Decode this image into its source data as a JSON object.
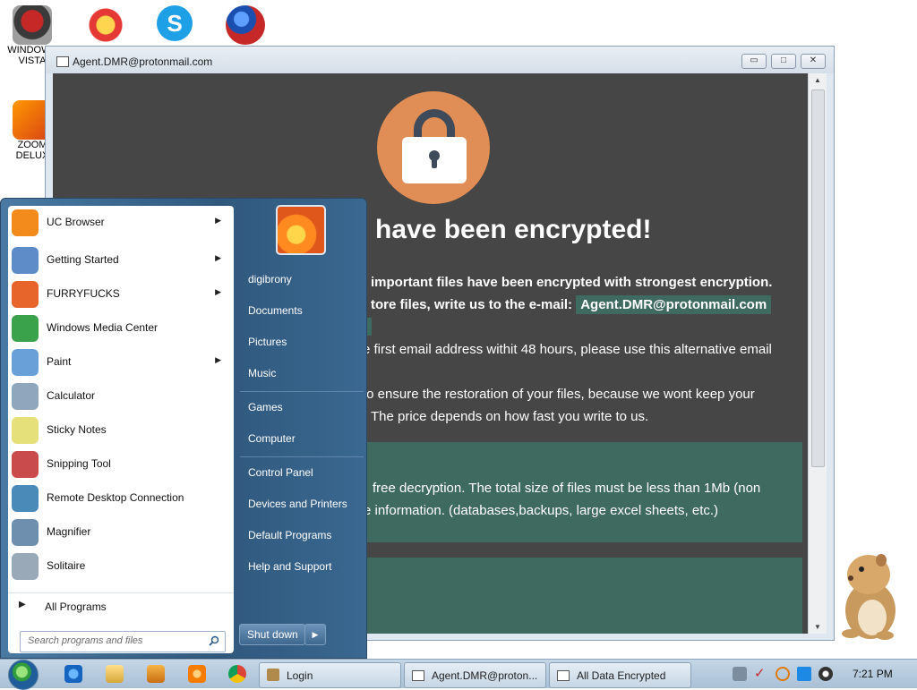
{
  "desktop": {
    "icons": [
      {
        "label": "WINDOWS VISTA",
        "icon": "windows-vista-icon"
      },
      {
        "label": "",
        "icon": "p-logo-icon"
      },
      {
        "label": "",
        "icon": "skype-icon"
      },
      {
        "label": "",
        "icon": "globe-icon"
      },
      {
        "label": "ZOOM DELUX",
        "icon": "zoom-deluxe-icon"
      }
    ]
  },
  "ransom_window": {
    "title": "Agent.DMR@protonmail.com",
    "controls": {
      "minimize": "▭",
      "maximize": "□",
      "close": "✕"
    },
    "heading": "have been encrypted!",
    "line1": "important files have been encrypted with strongest encryption.",
    "line2_prefix": "tore files, write us to the e-mail:",
    "email": "Agent.DMR@protonmail.com",
    "line3": "e first email address withit 48 hours, please use this alternative email",
    "line4": "to ensure the restoration of your files, because we wont keep your",
    "line5": "The price depends on how fast you write to us.",
    "box_line1": "free decryption. The total size of files must be less than 1Mb (non",
    "box_line2": "e information. (databases,backups, large excel sheets, etc.)"
  },
  "start_menu": {
    "programs": [
      {
        "label": "UC Browser",
        "icon": "uc-browser-icon",
        "submenu": true,
        "color": "#f28b1c"
      },
      {
        "label": "Getting Started",
        "icon": "getting-started-icon",
        "submenu": true,
        "color": "#5d8cc9"
      },
      {
        "label": "FURRYFUCKS",
        "icon": "firefox-icon",
        "submenu": true,
        "color": "#e7642a"
      },
      {
        "label": "Windows Media Center",
        "icon": "media-center-icon",
        "submenu": false,
        "color": "#3aa24a"
      },
      {
        "label": "Paint",
        "icon": "paint-icon",
        "submenu": true,
        "color": "#6aa0d8"
      },
      {
        "label": "Calculator",
        "icon": "calculator-icon",
        "submenu": false,
        "color": "#8fa6bd"
      },
      {
        "label": "Sticky Notes",
        "icon": "sticky-notes-icon",
        "submenu": false,
        "color": "#e6e07a"
      },
      {
        "label": "Snipping Tool",
        "icon": "snipping-tool-icon",
        "submenu": false,
        "color": "#c94b4b"
      },
      {
        "label": "Remote Desktop Connection",
        "icon": "remote-desktop-icon",
        "submenu": false,
        "color": "#4a8ab8"
      },
      {
        "label": "Magnifier",
        "icon": "magnifier-icon",
        "submenu": false,
        "color": "#6f8faf"
      },
      {
        "label": "Solitaire",
        "icon": "solitaire-icon",
        "submenu": false,
        "color": "#9aa9b8"
      }
    ],
    "all_programs": "All Programs",
    "search_placeholder": "Search programs and files",
    "right_items": [
      "digibrony",
      "Documents",
      "Pictures",
      "Music",
      "Games",
      "Computer",
      "Control Panel",
      "Devices and Printers",
      "Default Programs",
      "Help and Support"
    ],
    "shutdown": "Shut down"
  },
  "taskbar": {
    "buttons": [
      "Login",
      "Agent.DMR@proton...",
      "All Data Encrypted"
    ],
    "clock": "7:21 PM"
  }
}
